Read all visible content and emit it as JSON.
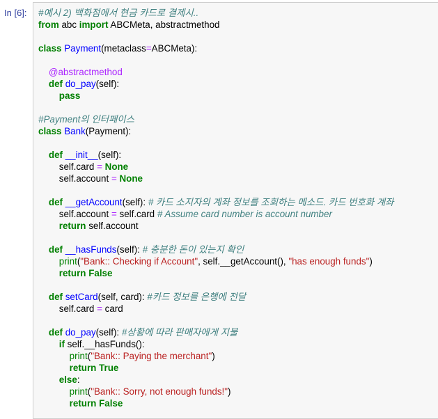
{
  "prompt": "In [6]:",
  "lines": [
    [
      {
        "t": "#예시 2) 백화점에서 현금 카드로 결제시..",
        "c": "c"
      }
    ],
    [
      {
        "t": "from",
        "c": "k"
      },
      {
        "t": " abc "
      },
      {
        "t": "import",
        "c": "k"
      },
      {
        "t": " ABCMeta, abstractmethod"
      }
    ],
    [],
    [
      {
        "t": "class",
        "c": "k"
      },
      {
        "t": " "
      },
      {
        "t": "Payment",
        "c": "cl"
      },
      {
        "t": "(metaclass"
      },
      {
        "t": "=",
        "c": "o"
      },
      {
        "t": "ABCMeta):"
      }
    ],
    [],
    [
      {
        "t": "    "
      },
      {
        "t": "@abstractmethod",
        "c": "d"
      }
    ],
    [
      {
        "t": "    "
      },
      {
        "t": "def",
        "c": "k"
      },
      {
        "t": " "
      },
      {
        "t": "do_pay",
        "c": "f"
      },
      {
        "t": "(self):"
      }
    ],
    [
      {
        "t": "        "
      },
      {
        "t": "pass",
        "c": "k"
      }
    ],
    [],
    [
      {
        "t": "#Payment의 인터페이스",
        "c": "c"
      }
    ],
    [
      {
        "t": "class",
        "c": "k"
      },
      {
        "t": " "
      },
      {
        "t": "Bank",
        "c": "cl"
      },
      {
        "t": "(Payment):"
      }
    ],
    [],
    [
      {
        "t": "    "
      },
      {
        "t": "def",
        "c": "k"
      },
      {
        "t": " "
      },
      {
        "t": "__init__",
        "c": "f"
      },
      {
        "t": "(self):"
      }
    ],
    [
      {
        "t": "        self.card "
      },
      {
        "t": "=",
        "c": "o"
      },
      {
        "t": " "
      },
      {
        "t": "None",
        "c": "k"
      }
    ],
    [
      {
        "t": "        self.account "
      },
      {
        "t": "=",
        "c": "o"
      },
      {
        "t": " "
      },
      {
        "t": "None",
        "c": "k"
      }
    ],
    [],
    [
      {
        "t": "    "
      },
      {
        "t": "def",
        "c": "k"
      },
      {
        "t": " "
      },
      {
        "t": "__getAccount",
        "c": "f"
      },
      {
        "t": "(self): "
      },
      {
        "t": "# 카드 소지자의 계좌 정보를 조회하는 메소드. 카드 번호화 계좌",
        "c": "c"
      }
    ],
    [
      {
        "t": "        self.account "
      },
      {
        "t": "=",
        "c": "o"
      },
      {
        "t": " self.card "
      },
      {
        "t": "# Assume card number is account number",
        "c": "c"
      }
    ],
    [
      {
        "t": "        "
      },
      {
        "t": "return",
        "c": "k"
      },
      {
        "t": " self.account"
      }
    ],
    [],
    [
      {
        "t": "    "
      },
      {
        "t": "def",
        "c": "k"
      },
      {
        "t": " "
      },
      {
        "t": "__hasFunds",
        "c": "f"
      },
      {
        "t": "(self): "
      },
      {
        "t": "# 충분한 돈이 있는지 확인",
        "c": "c"
      }
    ],
    [
      {
        "t": "        "
      },
      {
        "t": "print",
        "c": "k2"
      },
      {
        "t": "("
      },
      {
        "t": "\"Bank:: Checking if Account\"",
        "c": "s"
      },
      {
        "t": ", self.__getAccount(), "
      },
      {
        "t": "\"has enough funds\"",
        "c": "s"
      },
      {
        "t": ")"
      }
    ],
    [
      {
        "t": "        "
      },
      {
        "t": "return",
        "c": "k"
      },
      {
        "t": " "
      },
      {
        "t": "False",
        "c": "k"
      }
    ],
    [],
    [
      {
        "t": "    "
      },
      {
        "t": "def",
        "c": "k"
      },
      {
        "t": " "
      },
      {
        "t": "setCard",
        "c": "f"
      },
      {
        "t": "(self, card): "
      },
      {
        "t": "#카드 정보를 은행에 전달",
        "c": "c"
      }
    ],
    [
      {
        "t": "        self.card "
      },
      {
        "t": "=",
        "c": "o"
      },
      {
        "t": " card"
      }
    ],
    [],
    [
      {
        "t": "    "
      },
      {
        "t": "def",
        "c": "k"
      },
      {
        "t": " "
      },
      {
        "t": "do_pay",
        "c": "f"
      },
      {
        "t": "(self): "
      },
      {
        "t": "#상황에 따라 판매자에게 지불",
        "c": "c"
      }
    ],
    [
      {
        "t": "        "
      },
      {
        "t": "if",
        "c": "k"
      },
      {
        "t": " self.__hasFunds():"
      }
    ],
    [
      {
        "t": "            "
      },
      {
        "t": "print",
        "c": "k2"
      },
      {
        "t": "("
      },
      {
        "t": "\"Bank:: Paying the merchant\"",
        "c": "s"
      },
      {
        "t": ")"
      }
    ],
    [
      {
        "t": "            "
      },
      {
        "t": "return",
        "c": "k"
      },
      {
        "t": " "
      },
      {
        "t": "True",
        "c": "k"
      }
    ],
    [
      {
        "t": "        "
      },
      {
        "t": "else",
        "c": "k"
      },
      {
        "t": ":"
      }
    ],
    [
      {
        "t": "            "
      },
      {
        "t": "print",
        "c": "k2"
      },
      {
        "t": "("
      },
      {
        "t": "\"Bank:: Sorry, not enough funds!\"",
        "c": "s"
      },
      {
        "t": ")"
      }
    ],
    [
      {
        "t": "            "
      },
      {
        "t": "return",
        "c": "k"
      },
      {
        "t": " "
      },
      {
        "t": "False",
        "c": "k"
      }
    ]
  ]
}
